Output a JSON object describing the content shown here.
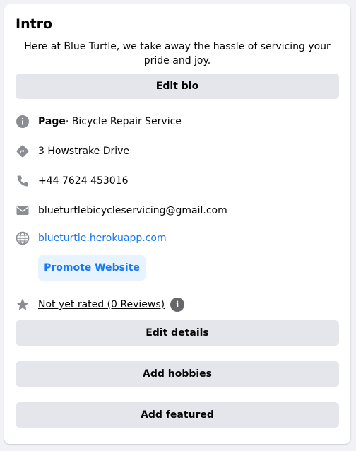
{
  "intro": {
    "title": "Intro",
    "bio": "Here at Blue Turtle, we take away the hassle of servicing your pride and joy.",
    "edit_bio_label": "Edit bio"
  },
  "details": {
    "page_label": "Page",
    "category": " · Bicycle Repair Service",
    "address": "3 Howstrake Drive",
    "phone": "+44 7624 453016",
    "email": "blueturtlebicycleservicing@gmail.com",
    "website": "blueturtle.herokuapp.com",
    "promote_label": "Promote Website",
    "rating": "Not yet rated (0 Reviews)",
    "info_glyph": "i"
  },
  "actions": {
    "edit_details_label": "Edit details",
    "add_hobbies_label": "Add hobbies",
    "add_featured_label": "Add featured"
  },
  "icons": {
    "page": "info-icon",
    "address": "directions-icon",
    "phone": "phone-icon",
    "email": "envelope-icon",
    "website": "globe-icon",
    "rating": "star-icon"
  },
  "colors": {
    "accent": "#1877f2",
    "button_bg": "#e4e6eb",
    "promote_bg": "#e7f3ff",
    "icon_gray": "#8a8d91"
  }
}
